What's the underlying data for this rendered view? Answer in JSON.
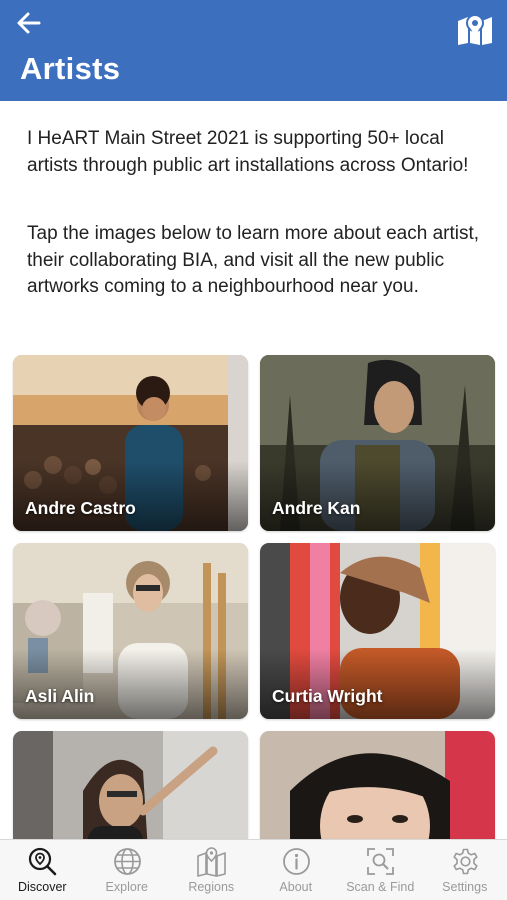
{
  "header": {
    "title": "Artists",
    "back_icon": "arrow-left-icon",
    "map_icon": "folded-map-pin-icon",
    "color": "#3d6fbf"
  },
  "intro": {
    "paragraph1": "I HeART Main Street 2021 is supporting 50+ local artists through public art installations across Ontario!",
    "paragraph2": "Tap the images below to learn more about each artist, their collaborating BIA, and visit all the new public artworks coming to a neighbourhood near you."
  },
  "artists": [
    {
      "name": "Andre Castro"
    },
    {
      "name": "Andre Kan"
    },
    {
      "name": "Asli Alin"
    },
    {
      "name": "Curtia Wright"
    },
    {
      "name": ""
    },
    {
      "name": ""
    }
  ],
  "tabs": [
    {
      "label": "Discover",
      "icon": "magnifier-pin-icon",
      "active": true
    },
    {
      "label": "Explore",
      "icon": "globe-icon",
      "active": false
    },
    {
      "label": "Regions",
      "icon": "map-icon",
      "active": false
    },
    {
      "label": "About",
      "icon": "info-icon",
      "active": false
    },
    {
      "label": "Scan & Find",
      "icon": "scan-icon",
      "active": false
    },
    {
      "label": "Settings",
      "icon": "gear-icon",
      "active": false
    }
  ]
}
